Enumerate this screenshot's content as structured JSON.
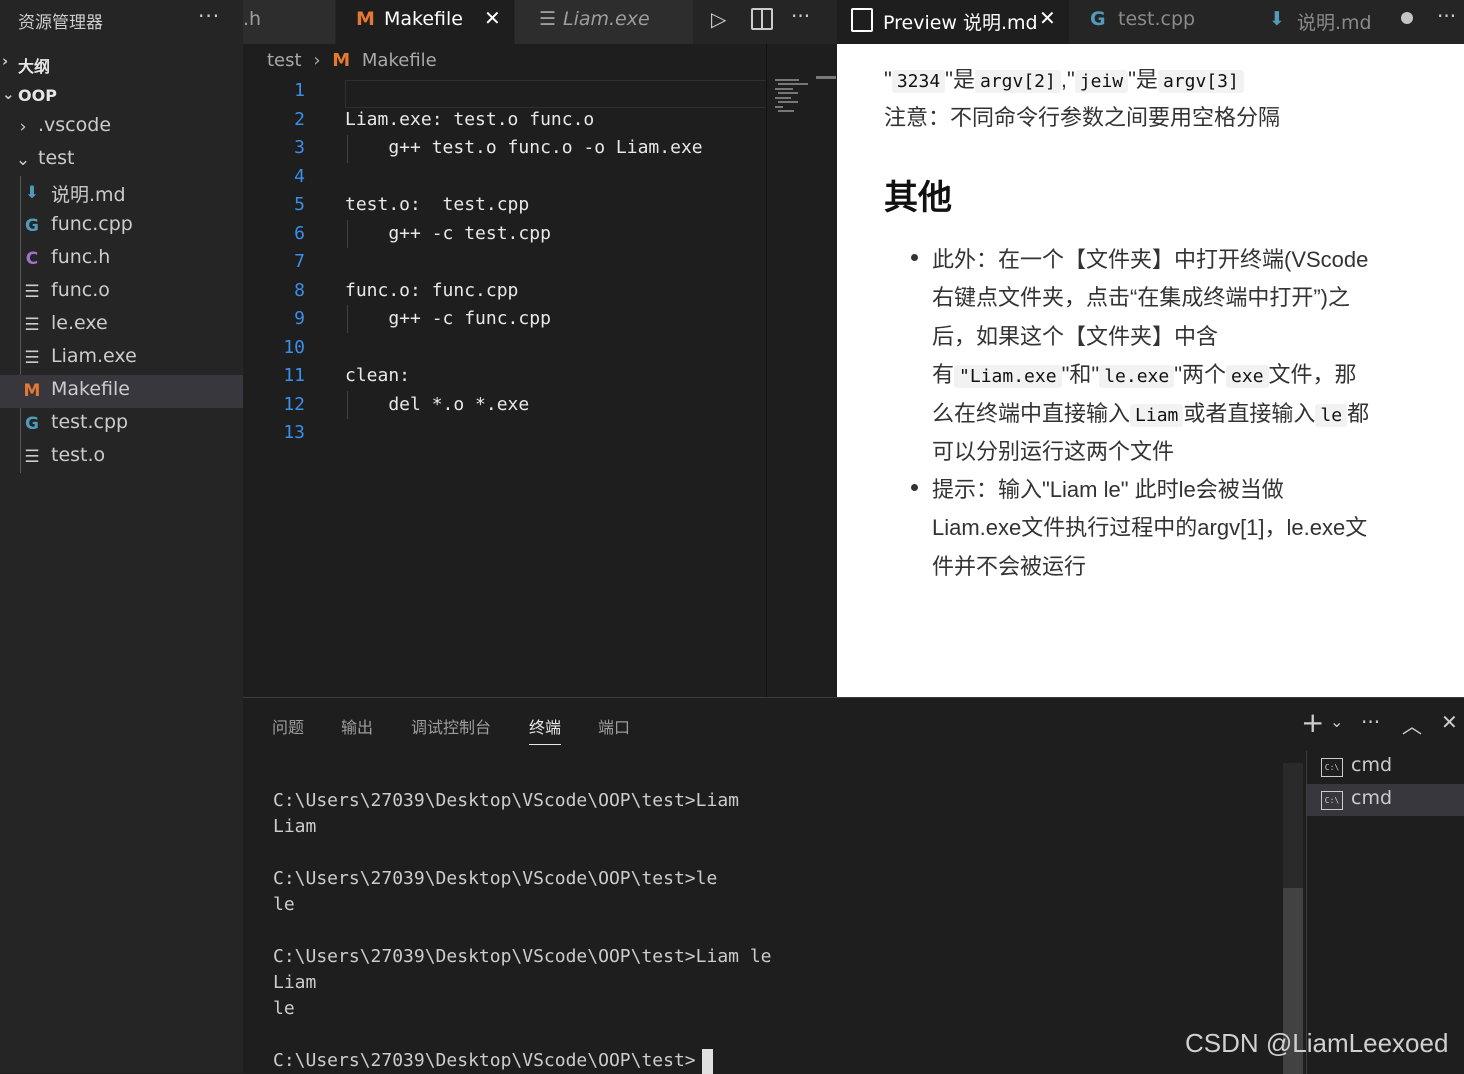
{
  "sidebar": {
    "title": "资源管理器",
    "more": "···",
    "outline": "大纲",
    "project": "OOP",
    "items": [
      {
        "label": ".vscode",
        "icon": "chevron-right-icon"
      },
      {
        "label": "test",
        "icon": "chevron-down-icon"
      },
      {
        "label": "说明.md",
        "icon": "markdown-file-icon"
      },
      {
        "label": "func.cpp",
        "icon": "cpp-file-icon"
      },
      {
        "label": "func.h",
        "icon": "c-header-file-icon"
      },
      {
        "label": "func.o",
        "icon": "binary-file-icon"
      },
      {
        "label": "le.exe",
        "icon": "binary-file-icon"
      },
      {
        "label": "Liam.exe",
        "icon": "binary-file-icon"
      },
      {
        "label": "Makefile",
        "icon": "makefile-icon",
        "selected": true
      },
      {
        "label": "test.cpp",
        "icon": "cpp-file-icon"
      },
      {
        "label": "test.o",
        "icon": "binary-file-icon"
      }
    ]
  },
  "editor": {
    "tabs": [
      {
        "label": ".h"
      },
      {
        "label": "Makefile",
        "active": true
      },
      {
        "label": "Liam.exe",
        "italic": true
      }
    ],
    "breadcrumb": {
      "folder": "test",
      "file": "Makefile"
    },
    "lines": [
      {
        "n": "1",
        "text": ""
      },
      {
        "n": "2",
        "text": "Liam.exe: test.o func.o"
      },
      {
        "n": "3",
        "text": "    g++ test.o func.o -o Liam.exe"
      },
      {
        "n": "4",
        "text": ""
      },
      {
        "n": "5",
        "text": "test.o:  test.cpp"
      },
      {
        "n": "6",
        "text": "    g++ -c test.cpp"
      },
      {
        "n": "7",
        "text": ""
      },
      {
        "n": "8",
        "text": "func.o: func.cpp"
      },
      {
        "n": "9",
        "text": "    g++ -c func.cpp"
      },
      {
        "n": "10",
        "text": ""
      },
      {
        "n": "11",
        "text": "clean:"
      },
      {
        "n": "12",
        "text": "    del *.o *.exe"
      },
      {
        "n": "13",
        "text": ""
      }
    ]
  },
  "preview": {
    "tabs": [
      {
        "label": "Preview 说明.md",
        "active": true
      },
      {
        "label": "test.cpp"
      },
      {
        "label": "说明.md"
      }
    ],
    "line_args": {
      "q1": "\"",
      "c1": "3234",
      "t1": "\"是",
      "c2": "argv[2]",
      "t2": ",\"",
      "c3": "jeiw",
      "t3": "\"是",
      "c4": "argv[3]"
    },
    "note": "注意：不同命令行参数之间要用空格分隔",
    "heading": "其他",
    "b1": {
      "l1": "此外：在一个【文件夹】中打开终端(VScode",
      "l2": "右键点文件夹，点击“在集成终端中打开”)之",
      "l3": "后，如果这个【文件夹】中含",
      "l4a": "有",
      "l4c1": "\"Liam.exe",
      "l4b": "\"和\"",
      "l4c2": "le.exe",
      "l4d": "\"两个",
      "l4c3": "exe",
      "l4e": "文件，那",
      "l5a": "么在终端中直接输入",
      "l5c1": "Liam",
      "l5b": "或者直接输入",
      "l5c2": "le",
      "l5d": "都",
      "l6": "可以分别运行这两个文件"
    },
    "b2": {
      "l1": "提示：输入\"Liam le\" 此时le会被当做",
      "l2": "Liam.exe文件执行过程中的argv[1]，le.exe文",
      "l3": "件并不会被运行"
    }
  },
  "panel": {
    "tabs": [
      "问题",
      "输出",
      "调试控制台",
      "终端",
      "端口"
    ],
    "active_tab": "终端",
    "terminal_lines": [
      "C:\\Users\\27039\\Desktop\\VScode\\OOP\\test>Liam",
      "Liam",
      "",
      "C:\\Users\\27039\\Desktop\\VScode\\OOP\\test>le",
      "le",
      "",
      "C:\\Users\\27039\\Desktop\\VScode\\OOP\\test>Liam le",
      "Liam",
      "le",
      "",
      "C:\\Users\\27039\\Desktop\\VScode\\OOP\\test>"
    ],
    "terminals": [
      {
        "label": "cmd"
      },
      {
        "label": "cmd",
        "selected": true
      }
    ]
  },
  "watermark": "CSDN @LiamLeexoed",
  "colors": {
    "accent": "#3b8eea",
    "makefile": "#e37933",
    "markdown": "#519aba",
    "cpp": "#519aba"
  }
}
